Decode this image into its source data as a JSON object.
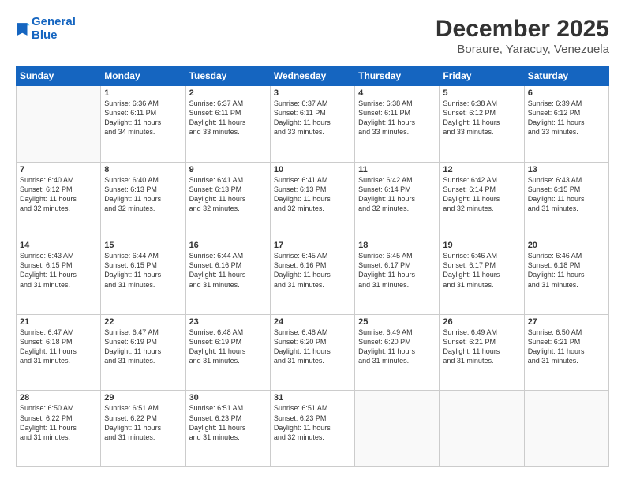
{
  "logo": {
    "line1": "General",
    "line2": "Blue"
  },
  "title": "December 2025",
  "location": "Boraure, Yaracuy, Venezuela",
  "header_days": [
    "Sunday",
    "Monday",
    "Tuesday",
    "Wednesday",
    "Thursday",
    "Friday",
    "Saturday"
  ],
  "weeks": [
    [
      {
        "day": "",
        "info": ""
      },
      {
        "day": "1",
        "info": "Sunrise: 6:36 AM\nSunset: 6:11 PM\nDaylight: 11 hours\nand 34 minutes."
      },
      {
        "day": "2",
        "info": "Sunrise: 6:37 AM\nSunset: 6:11 PM\nDaylight: 11 hours\nand 33 minutes."
      },
      {
        "day": "3",
        "info": "Sunrise: 6:37 AM\nSunset: 6:11 PM\nDaylight: 11 hours\nand 33 minutes."
      },
      {
        "day": "4",
        "info": "Sunrise: 6:38 AM\nSunset: 6:11 PM\nDaylight: 11 hours\nand 33 minutes."
      },
      {
        "day": "5",
        "info": "Sunrise: 6:38 AM\nSunset: 6:12 PM\nDaylight: 11 hours\nand 33 minutes."
      },
      {
        "day": "6",
        "info": "Sunrise: 6:39 AM\nSunset: 6:12 PM\nDaylight: 11 hours\nand 33 minutes."
      }
    ],
    [
      {
        "day": "7",
        "info": "Sunrise: 6:40 AM\nSunset: 6:12 PM\nDaylight: 11 hours\nand 32 minutes."
      },
      {
        "day": "8",
        "info": "Sunrise: 6:40 AM\nSunset: 6:13 PM\nDaylight: 11 hours\nand 32 minutes."
      },
      {
        "day": "9",
        "info": "Sunrise: 6:41 AM\nSunset: 6:13 PM\nDaylight: 11 hours\nand 32 minutes."
      },
      {
        "day": "10",
        "info": "Sunrise: 6:41 AM\nSunset: 6:13 PM\nDaylight: 11 hours\nand 32 minutes."
      },
      {
        "day": "11",
        "info": "Sunrise: 6:42 AM\nSunset: 6:14 PM\nDaylight: 11 hours\nand 32 minutes."
      },
      {
        "day": "12",
        "info": "Sunrise: 6:42 AM\nSunset: 6:14 PM\nDaylight: 11 hours\nand 32 minutes."
      },
      {
        "day": "13",
        "info": "Sunrise: 6:43 AM\nSunset: 6:15 PM\nDaylight: 11 hours\nand 31 minutes."
      }
    ],
    [
      {
        "day": "14",
        "info": "Sunrise: 6:43 AM\nSunset: 6:15 PM\nDaylight: 11 hours\nand 31 minutes."
      },
      {
        "day": "15",
        "info": "Sunrise: 6:44 AM\nSunset: 6:15 PM\nDaylight: 11 hours\nand 31 minutes."
      },
      {
        "day": "16",
        "info": "Sunrise: 6:44 AM\nSunset: 6:16 PM\nDaylight: 11 hours\nand 31 minutes."
      },
      {
        "day": "17",
        "info": "Sunrise: 6:45 AM\nSunset: 6:16 PM\nDaylight: 11 hours\nand 31 minutes."
      },
      {
        "day": "18",
        "info": "Sunrise: 6:45 AM\nSunset: 6:17 PM\nDaylight: 11 hours\nand 31 minutes."
      },
      {
        "day": "19",
        "info": "Sunrise: 6:46 AM\nSunset: 6:17 PM\nDaylight: 11 hours\nand 31 minutes."
      },
      {
        "day": "20",
        "info": "Sunrise: 6:46 AM\nSunset: 6:18 PM\nDaylight: 11 hours\nand 31 minutes."
      }
    ],
    [
      {
        "day": "21",
        "info": "Sunrise: 6:47 AM\nSunset: 6:18 PM\nDaylight: 11 hours\nand 31 minutes."
      },
      {
        "day": "22",
        "info": "Sunrise: 6:47 AM\nSunset: 6:19 PM\nDaylight: 11 hours\nand 31 minutes."
      },
      {
        "day": "23",
        "info": "Sunrise: 6:48 AM\nSunset: 6:19 PM\nDaylight: 11 hours\nand 31 minutes."
      },
      {
        "day": "24",
        "info": "Sunrise: 6:48 AM\nSunset: 6:20 PM\nDaylight: 11 hours\nand 31 minutes."
      },
      {
        "day": "25",
        "info": "Sunrise: 6:49 AM\nSunset: 6:20 PM\nDaylight: 11 hours\nand 31 minutes."
      },
      {
        "day": "26",
        "info": "Sunrise: 6:49 AM\nSunset: 6:21 PM\nDaylight: 11 hours\nand 31 minutes."
      },
      {
        "day": "27",
        "info": "Sunrise: 6:50 AM\nSunset: 6:21 PM\nDaylight: 11 hours\nand 31 minutes."
      }
    ],
    [
      {
        "day": "28",
        "info": "Sunrise: 6:50 AM\nSunset: 6:22 PM\nDaylight: 11 hours\nand 31 minutes."
      },
      {
        "day": "29",
        "info": "Sunrise: 6:51 AM\nSunset: 6:22 PM\nDaylight: 11 hours\nand 31 minutes."
      },
      {
        "day": "30",
        "info": "Sunrise: 6:51 AM\nSunset: 6:23 PM\nDaylight: 11 hours\nand 31 minutes."
      },
      {
        "day": "31",
        "info": "Sunrise: 6:51 AM\nSunset: 6:23 PM\nDaylight: 11 hours\nand 32 minutes."
      },
      {
        "day": "",
        "info": ""
      },
      {
        "day": "",
        "info": ""
      },
      {
        "day": "",
        "info": ""
      }
    ]
  ]
}
